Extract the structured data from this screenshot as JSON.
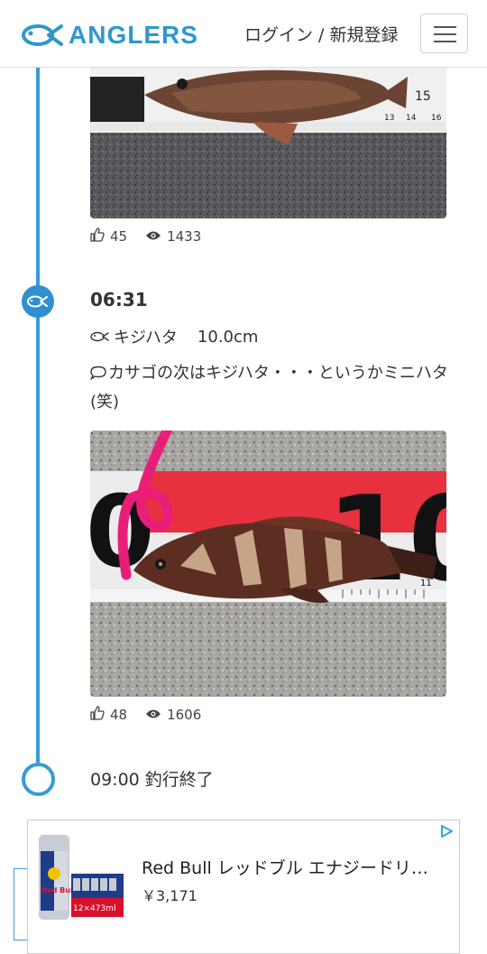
{
  "header": {
    "logo_text": "ANGLERS",
    "login_label": "ログイン / 新規登録"
  },
  "entries": [
    {
      "likes": "45",
      "views": "1433"
    },
    {
      "time": "06:31",
      "species": "キジハタ",
      "size": "10.0cm",
      "comment": "カサゴの次はキジハタ・・・というかミニハタ(笑)",
      "likes": "48",
      "views": "1606"
    }
  ],
  "end": {
    "label": "09:00 釣行終了"
  },
  "ad": {
    "title": "Red Bull レッドブル エナジードリンク",
    "price": "￥3,171",
    "can_brand": "Red Bull",
    "pack_label": "12×473ml"
  },
  "colors": {
    "brand": "#2f97cf",
    "timeline": "#3a9ad6"
  },
  "icons": {
    "logo": "fish-logo-icon",
    "menu": "hamburger-menu-icon",
    "like": "thumbs-up-icon",
    "view": "eye-icon",
    "fish": "fish-icon",
    "comment": "speech-bubble-icon",
    "ad_choices": "ad-choices-icon"
  }
}
